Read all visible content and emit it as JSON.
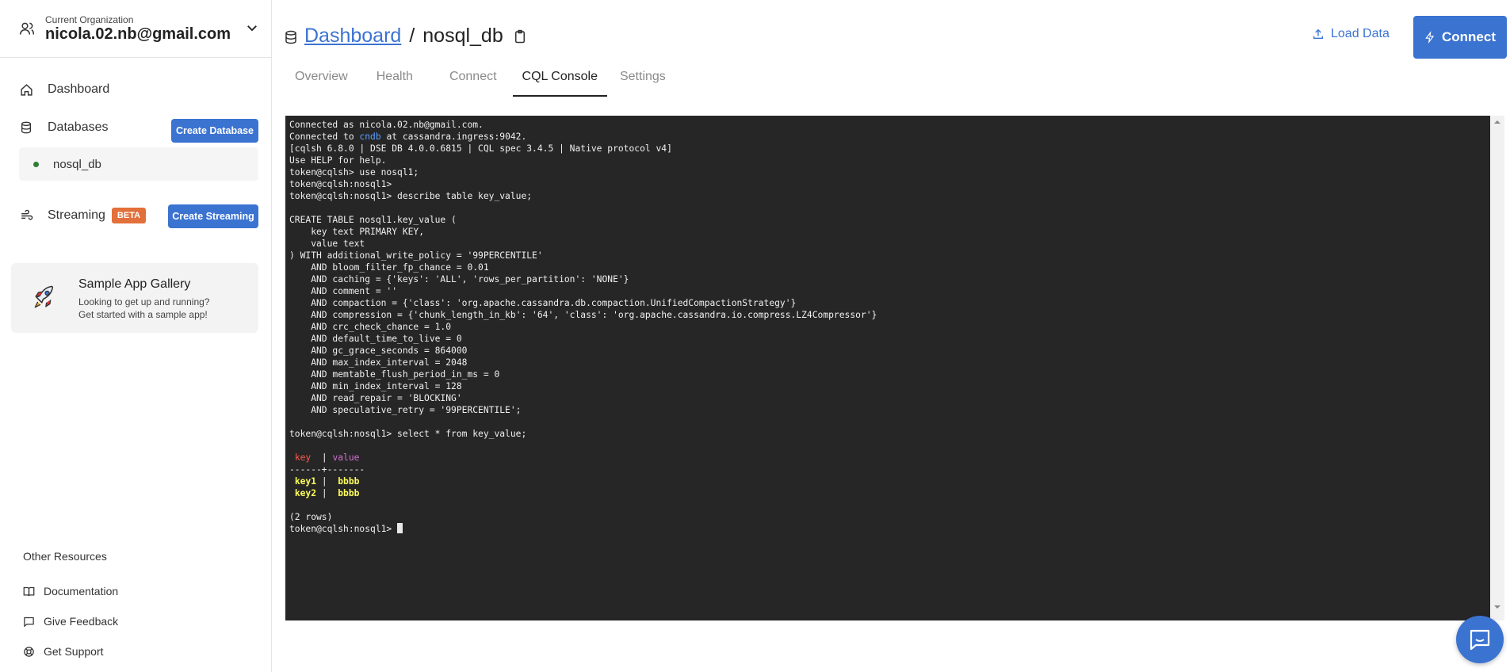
{
  "org": {
    "caption": "Current Organization",
    "name": "nicola.02.nb@gmail.com"
  },
  "sidebar": {
    "dashboard_label": "Dashboard",
    "databases_label": "Databases",
    "create_database_label": "Create Database",
    "database_item": "nosql_db",
    "streaming_label": "Streaming",
    "beta_badge": "BETA",
    "create_streaming_label": "Create Streaming",
    "gallery_title": "Sample App Gallery",
    "gallery_sub1": "Looking to get up and running?",
    "gallery_sub2": "Get started with a sample app!",
    "resources_title": "Other Resources",
    "resources": [
      "Documentation",
      "Give Feedback",
      "Get Support"
    ]
  },
  "header": {
    "breadcrumb_link": "Dashboard",
    "breadcrumb_sep": "/",
    "breadcrumb_current": "nosql_db",
    "load_data_label": "Load Data",
    "connect_label": "Connect"
  },
  "tabs": [
    "Overview",
    "Health",
    "Connect",
    "CQL Console",
    "Settings"
  ],
  "active_tab": "CQL Console",
  "console": {
    "lines": [
      "Connected as nicola.02.nb@gmail.com.",
      "Connected to |cndb| at cassandra.ingress:9042.",
      "[cqlsh 6.8.0 | DSE DB 4.0.0.6815 | CQL spec 3.4.5 | Native protocol v4]",
      "Use HELP for help.",
      "token@cqlsh> use nosql1;",
      "token@cqlsh:nosql1>",
      "token@cqlsh:nosql1> describe table key_value;",
      "",
      "CREATE TABLE nosql1.key_value (",
      "    key text PRIMARY KEY,",
      "    value text",
      ") WITH additional_write_policy = '99PERCENTILE'",
      "    AND bloom_filter_fp_chance = 0.01",
      "    AND caching = {'keys': 'ALL', 'rows_per_partition': 'NONE'}",
      "    AND comment = ''",
      "    AND compaction = {'class': 'org.apache.cassandra.db.compaction.UnifiedCompactionStrategy'}",
      "    AND compression = {'chunk_length_in_kb': '64', 'class': 'org.apache.cassandra.io.compress.LZ4Compressor'}",
      "    AND crc_check_chance = 1.0",
      "    AND default_time_to_live = 0",
      "    AND gc_grace_seconds = 864000",
      "    AND max_index_interval = 2048",
      "    AND memtable_flush_period_in_ms = 0",
      "    AND min_index_interval = 128",
      "    AND read_repair = 'BLOCKING'",
      "    AND speculative_retry = '99PERCENTILE';",
      "",
      "token@cqlsh:nosql1> select * from key_value;",
      ""
    ],
    "result_header": {
      "col1": "key",
      "col2": "value"
    },
    "result_divider": "------+-------",
    "result_rows": [
      {
        "key": "key1",
        "value": "bbbb"
      },
      {
        "key": "key2",
        "value": "bbbb"
      }
    ],
    "row_count": "(2 rows)",
    "prompt": "token@cqlsh:nosql1> "
  },
  "colors": {
    "accent": "#3b73d1",
    "terminal_bg": "#262626",
    "beta": "#e2703a"
  }
}
